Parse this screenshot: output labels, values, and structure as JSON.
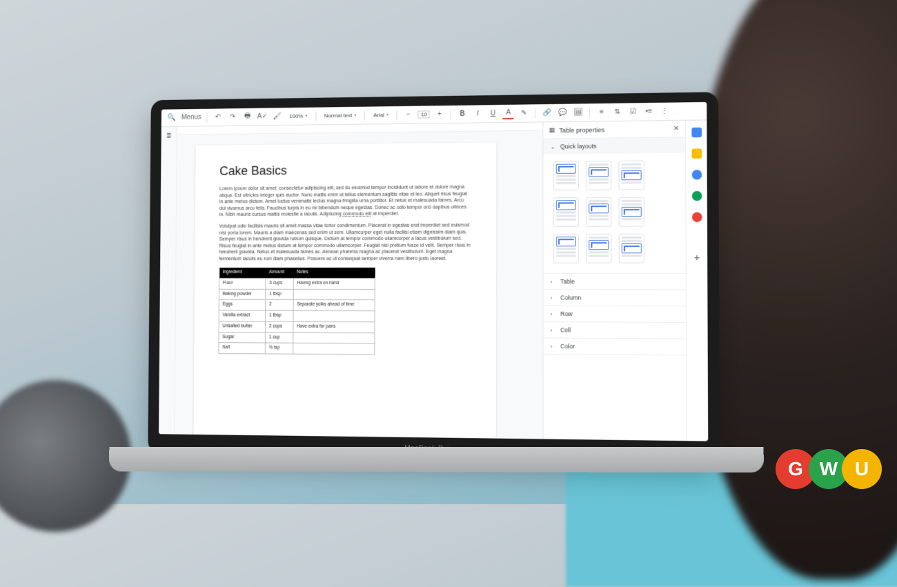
{
  "toolbar": {
    "menus": "Menus",
    "zoom": "100%",
    "style": "Normal text",
    "font": "Arial",
    "font_size": "10"
  },
  "doc": {
    "title": "Cake Basics",
    "para1_html": "Lorem ipsum dolor sit amet, consectetur adipiscing elit, sed do eiusmod tempor incididunt ut labore et dolore magna aliqua. Est ultricies integer quis auctor. Nunc mattis enim ut tellus elementum sagittis vitae et leo. Aliquet risus feugiat in ante metus dictum. Amet luctus venenatis lectus magna fringilla urna porttitor. Et netus et malesuada fames. Arcu dui vivamus arcu felis. Faucibus turpis in eu mi bibendum neque egestas. Donec ac odio tempor orci dapibus ultrices in. Nibh mauris cursus mattis molestie a iaculis. Adipiscing <u class=\"dotted\">commodo elit</u> at imperdiet.",
    "para2": "Volutpat odio facilisis mauris sit amet massa vitae tortor condimentum. Placerat in egestas erat imperdiet sed euismod nisi porta lorem. Mauris a diam maecenas sed enim ut sem. Ullamcorper eget nulla facilisi etiam dignissim diam quis. Semper risus in hendrerit gravida rutrum quisque. Dictum at tempor commodo ullamcorper a lacus vestibulum sed. Risus feugiat in ante metus dictum at tempor commodo ullamcorper. Feugiat nisl pretium fusce id velit. Semper risus in hendrerit gravida. Netus et malesuada fames ac. Aenean pharetra magna ac placerat vestibulum. Eget magna fermentum iaculis eu non diam phasellus. Posuere ac ut consequat semper viverra nam libero justo laoreet.",
    "table": {
      "headers": [
        "Ingredient",
        "Amount",
        "Notes"
      ],
      "rows": [
        [
          "Flour",
          "3 cups",
          "Having extra on hand"
        ],
        [
          "Baking powder",
          "1 tbsp",
          ""
        ],
        [
          "Eggs",
          "2",
          "Separate yolks ahead of time"
        ],
        [
          "Vanilla extract",
          "1 tbsp",
          ""
        ],
        [
          "Unsalted butter",
          "2 cups",
          "Have extra for pans"
        ],
        [
          "Sugar",
          "1 cup",
          ""
        ],
        [
          "Salt",
          "½ tsp",
          ""
        ]
      ]
    }
  },
  "panel": {
    "title": "Table properties",
    "sections": {
      "quick": "Quick layouts",
      "table": "Table",
      "column": "Column",
      "row": "Row",
      "cell": "Cell",
      "color": "Color"
    }
  }
}
